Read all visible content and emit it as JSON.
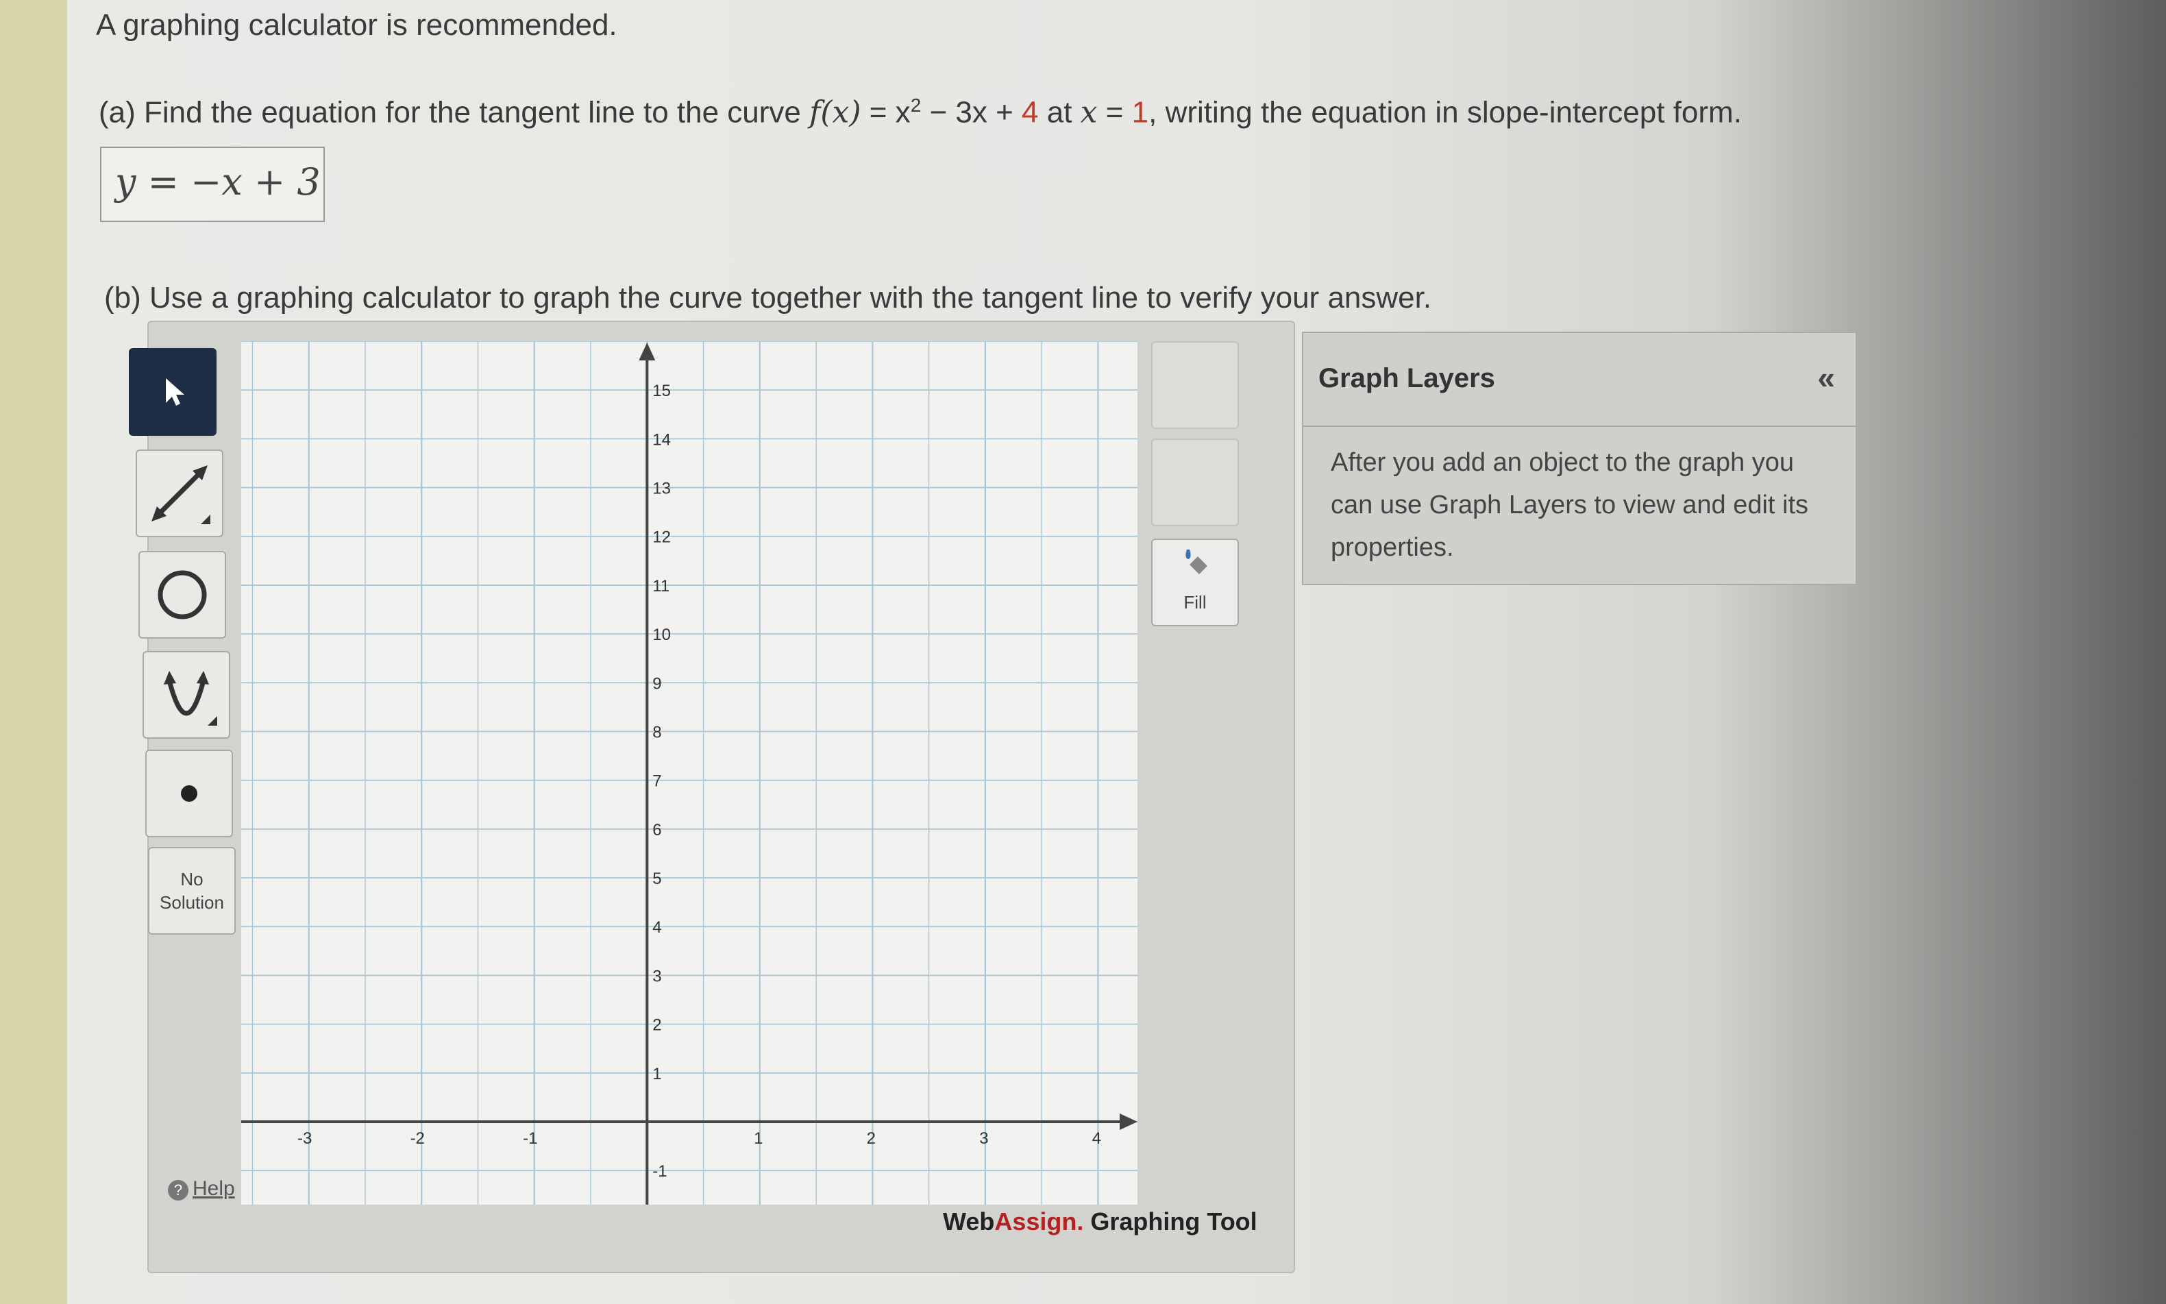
{
  "intro": "A graphing calculator is recommended.",
  "part_a": {
    "prefix": "(a) Find the equation for the tangent line to the curve ",
    "func_name": "f(x)",
    "func_expr_1": " = x",
    "exponent": "2",
    "func_expr_2": " − 3x + ",
    "constant": "4",
    "at_text": " at ",
    "x_var": "x",
    "equals": " = ",
    "x_value": "1",
    "suffix": ", writing the equation in slope-intercept form.",
    "answer": "y = −x + 3"
  },
  "part_b": "(b) Use a graphing calculator to graph the curve together with the tangent line to verify your answer.",
  "tools": {
    "no_solution_line1": "No",
    "no_solution_line2": "Solution",
    "help": "Help",
    "fill": "Fill"
  },
  "graph": {
    "x_labels": [
      "-3",
      "-2",
      "-1",
      "1",
      "2",
      "3",
      "4"
    ],
    "y_labels": [
      "-1",
      "1",
      "2",
      "3",
      "4",
      "5",
      "6",
      "7",
      "8",
      "9",
      "10",
      "11",
      "12",
      "13",
      "14",
      "15"
    ]
  },
  "branding": {
    "web": "Web",
    "assign": "Assign.",
    "rest": " Graphing Tool"
  },
  "layers": {
    "title": "Graph Layers",
    "collapse": "«",
    "message": "After you add an object to the graph you can use Graph Layers to view and edit its properties."
  },
  "colors": {
    "accent_red": "#c0392b",
    "select_tool_bg": "#1e2d45",
    "grid_line": "#a9c6d6"
  }
}
